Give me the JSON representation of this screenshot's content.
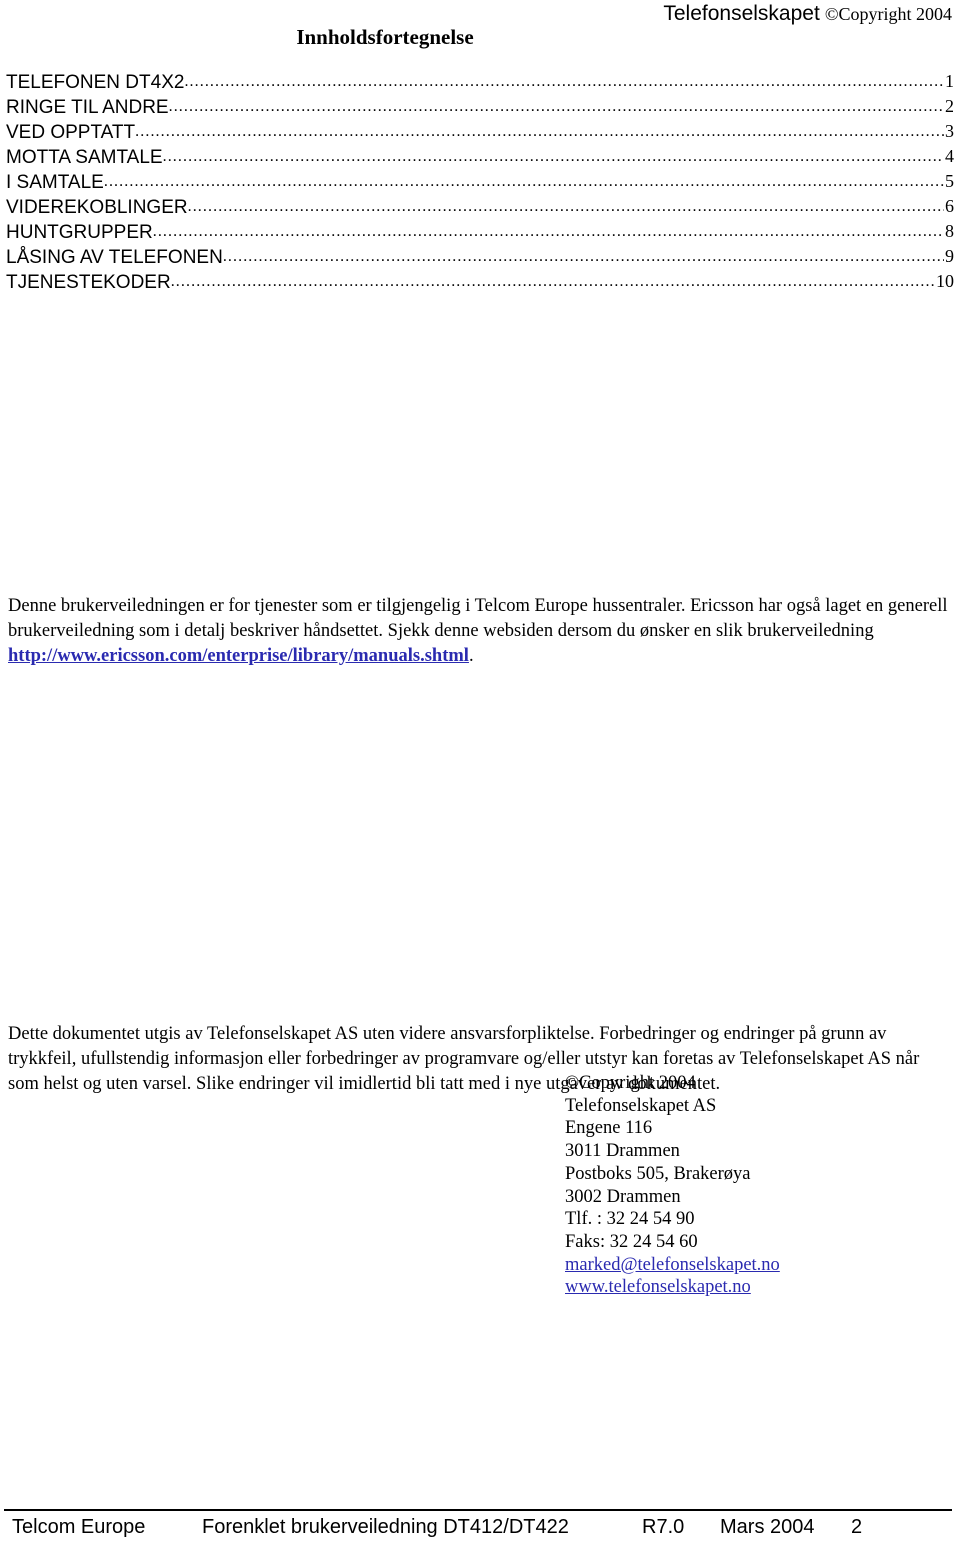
{
  "header": {
    "company_name": "Telefonselskapet",
    "copyright_note": "©Copyright 2004",
    "toc_title": "Innholdsfortegnelse"
  },
  "toc": {
    "leader_dots": "..........................................................................................................................................................................................................................................",
    "entries": [
      {
        "label": "TELEFONEN DT4X2",
        "page": "1"
      },
      {
        "label": "RINGE TIL ANDRE ",
        "page": "2"
      },
      {
        "label": "VED OPPTATT ",
        "page": "3"
      },
      {
        "label": "MOTTA SAMTALE ",
        "page": "4"
      },
      {
        "label": "I SAMTALE ",
        "page": "5"
      },
      {
        "label": "VIDEREKOBLINGER ",
        "page": "6"
      },
      {
        "label": "HUNTGRUPPER ",
        "page": "8"
      },
      {
        "label": "LÅSING AV TELEFONEN ",
        "page": "9"
      },
      {
        "label": "TJENESTEKODER ",
        "page": "10"
      }
    ]
  },
  "intro": {
    "text_before_link": "Denne brukerveiledningen er for tjenester som er tilgjengelig i Telcom Europe hussentraler.  Ericsson har også laget en generell brukerveiledning som i detalj beskriver håndsettet. Sjekk denne websiden dersom du ønsker en slik brukerveiledning ",
    "link_text": "http://www.ericsson.com/enterprise/library/manuals.shtml",
    "text_after_link": "."
  },
  "disclaimer": {
    "text": "Dette dokumentet utgis av Telefonselskapet AS uten videre ansvarsforpliktelse. Forbedringer og endringer på grunn av trykkfeil, ufullstendig informasjon eller forbedringer av programvare og/eller utstyr kan foretas av Telefonselskapet AS når som helst og uten varsel.  Slike endringer vil imidlertid bli tatt med i nye utgaver av dokumentet."
  },
  "address": {
    "lines": [
      "©Copyright 2004",
      "Telefonselskapet AS",
      "Engene 116",
      "3011 Drammen",
      "Postboks 505, Brakerøya",
      "3002 Drammen",
      "Tlf. :  32 24 54 90",
      "Faks:  32 24 54 60"
    ],
    "email": "marked@telefonselskapet.no",
    "website": "www.telefonselskapet.no"
  },
  "footer": {
    "company": "Telcom Europe",
    "document": "Forenklet brukerveiledning DT412/DT422",
    "revision": "R7.0",
    "date": "Mars 2004",
    "page_number": "2"
  },
  "colors": {
    "link": "#2a2ab0",
    "text": "#000000",
    "background": "#ffffff"
  }
}
